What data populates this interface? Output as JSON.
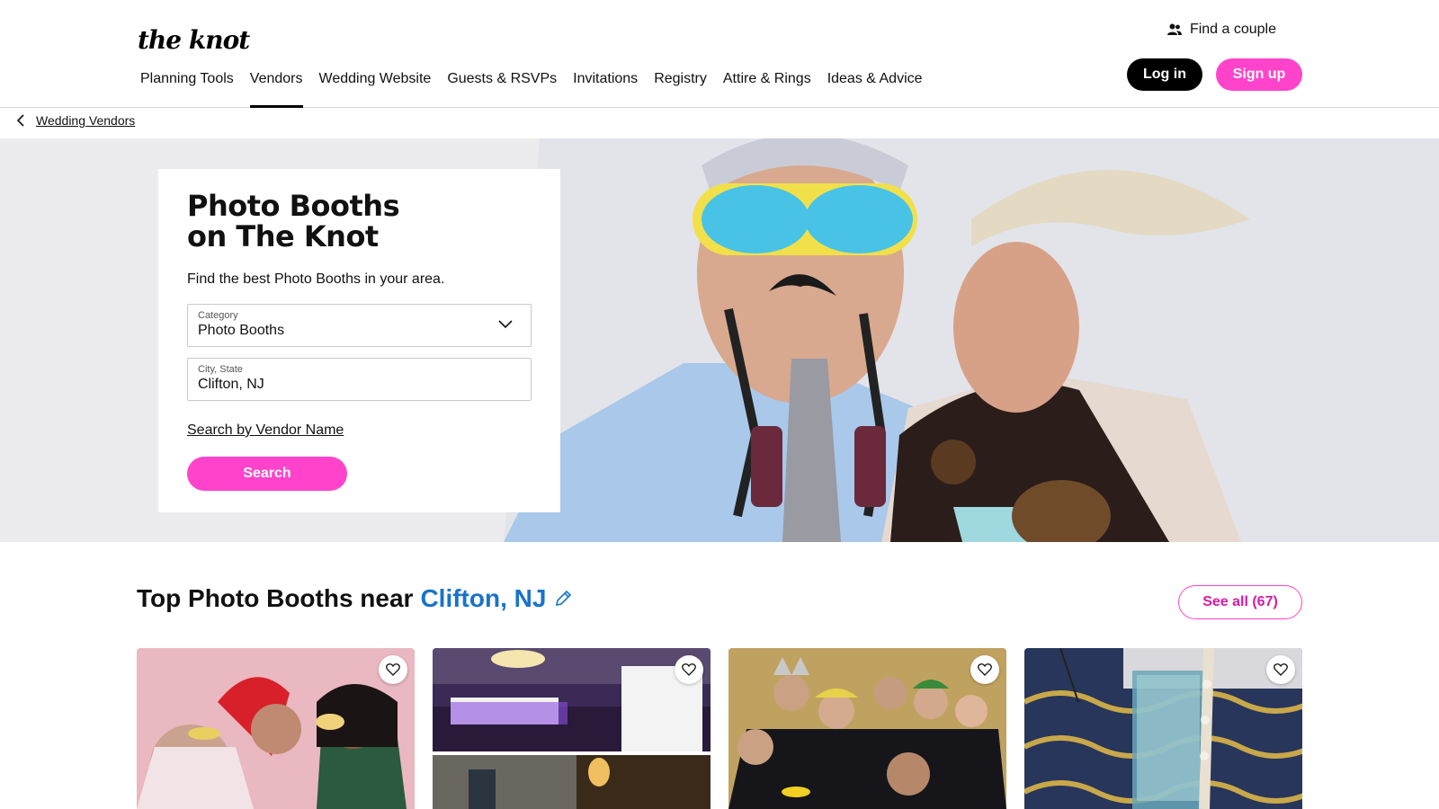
{
  "header": {
    "logo": "the knot",
    "find_couple": "Find a couple",
    "nav": [
      {
        "label": "Planning Tools"
      },
      {
        "label": "Vendors",
        "active": true
      },
      {
        "label": "Wedding Website"
      },
      {
        "label": "Guests & RSVPs"
      },
      {
        "label": "Invitations"
      },
      {
        "label": "Registry"
      },
      {
        "label": "Attire & Rings"
      },
      {
        "label": "Ideas & Advice"
      }
    ],
    "login_label": "Log in",
    "signup_label": "Sign up"
  },
  "breadcrumb": {
    "label": "Wedding Vendors"
  },
  "hero": {
    "title_line1": "Photo Booths",
    "title_line2": "on The Knot",
    "subtitle": "Find the best Photo Booths in your area.",
    "category_label": "Category",
    "category_value": "Photo Booths",
    "city_label": "City, State",
    "city_value": "Clifton, NJ",
    "vendor_link": "Search by Vendor Name",
    "search_label": "Search"
  },
  "section": {
    "title_prefix": "Top Photo Booths near",
    "location": "Clifton, NJ",
    "see_all": "See all (67)"
  },
  "colors": {
    "accent_pink": "#ff44cb",
    "link_blue": "#1a73c9",
    "black": "#000000"
  },
  "icons": [
    "person-group-icon",
    "chevron-left-icon",
    "chevron-down-icon",
    "pencil-icon",
    "heart-icon"
  ]
}
